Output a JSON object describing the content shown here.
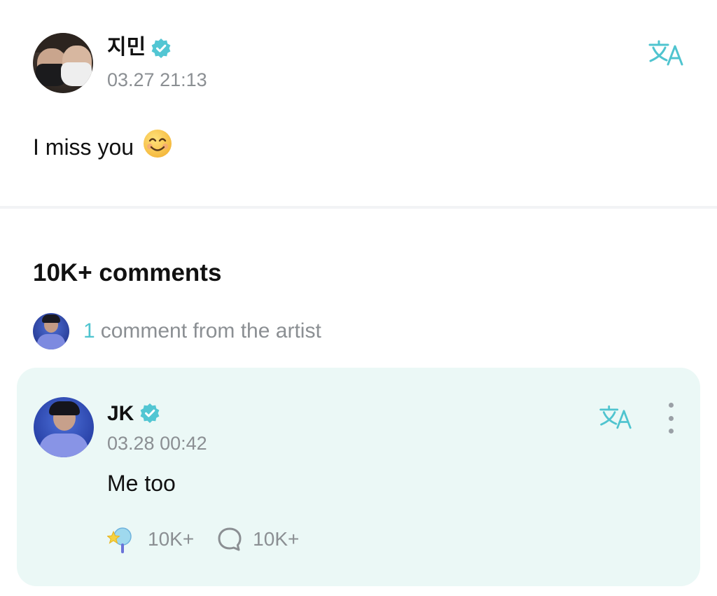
{
  "post": {
    "author": "지민",
    "timestamp": "03.27 21:13",
    "body": "I miss you",
    "emoji": "smiling-face-icon"
  },
  "comments": {
    "title": "10K+ comments",
    "artist_comments": {
      "count": "1",
      "label": "comment from the artist"
    }
  },
  "artist_comment": {
    "author": "JK",
    "timestamp": "03.28 00:42",
    "text": "Me too",
    "likes": "10K+",
    "replies": "10K+"
  },
  "colors": {
    "accent": "#4fc4cf",
    "card_background": "#ebf8f6",
    "muted_text": "#8b8f93"
  },
  "icons": [
    "verified-badge-icon",
    "translate-icon",
    "more-options-icon",
    "sparkle-like-icon",
    "comment-bubble-icon"
  ]
}
